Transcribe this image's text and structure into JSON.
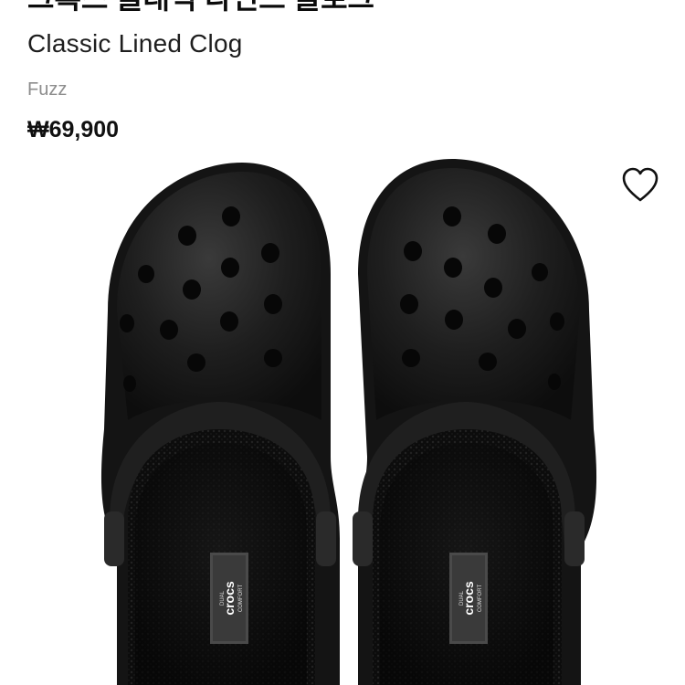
{
  "product": {
    "name_ko": "크록스 클래식 라인드 클로그",
    "name_en": "Classic Lined Clog",
    "variant": "Fuzz",
    "price": "₩69,900"
  },
  "wishlist": {
    "icon": "heart-outline-icon",
    "active": false
  },
  "image": {
    "subject": "product-image-black-lined-clogs",
    "logo_text": "crocs",
    "logo_sub_top": "DUAL",
    "logo_sub_bottom": "COMFORT"
  },
  "colors": {
    "text_primary": "#111111",
    "text_secondary": "#8d8d8d",
    "shoe_body": "#1c1c1c",
    "lining": "#101010"
  }
}
